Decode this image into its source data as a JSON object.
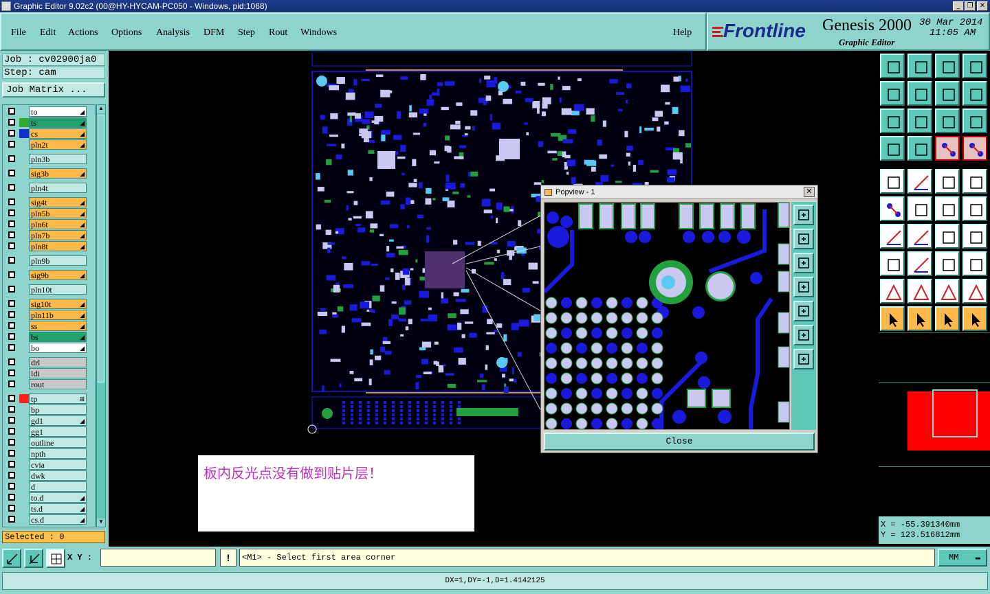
{
  "window": {
    "title": "Graphic Editor 9.02c2 (00@HY-HYCAM-PC050 - Windows, pid:1068)",
    "controls": [
      "_",
      "❐",
      "✕"
    ]
  },
  "menu": {
    "items": [
      "File",
      "Edit",
      "Actions",
      "Options",
      "Analysis",
      "DFM",
      "Step",
      "Rout",
      "Windows"
    ],
    "help": "Help"
  },
  "brand": {
    "logo": "Frontline",
    "product": "Genesis 2000",
    "subtitle": "Graphic Editor",
    "date": "30 Mar 2014",
    "time": "11:05 AM"
  },
  "job": {
    "job_label": "Job : cv02900ja0",
    "step_label": "Step: cam",
    "matrix_button": "Job Matrix ..."
  },
  "layers": [
    {
      "name": "to",
      "bg": "#ffffff",
      "color": "",
      "mark": "◢"
    },
    {
      "name": "ts",
      "bg": "#22a06c",
      "color": "#33aa33",
      "mark": "◢"
    },
    {
      "name": "cs",
      "bg": "#ffb84a",
      "color": "#1030d0",
      "mark": "◢"
    },
    {
      "name": "pln2t",
      "bg": "#ffb84a",
      "color": "",
      "mark": "◢"
    },
    {
      "name": "pln3b",
      "bg": "#bfe8e2",
      "color": "",
      "mark": ""
    },
    {
      "name": "sig3b",
      "bg": "#ffb84a",
      "color": "",
      "mark": "◢"
    },
    {
      "name": "pln4t",
      "bg": "#bfe8e2",
      "color": "",
      "mark": ""
    },
    {
      "name": "sig4t",
      "bg": "#ffb84a",
      "color": "",
      "mark": "◢"
    },
    {
      "name": "pln5b",
      "bg": "#ffb84a",
      "color": "",
      "mark": "◢"
    },
    {
      "name": "pln6t",
      "bg": "#ffb84a",
      "color": "",
      "mark": "◢"
    },
    {
      "name": "pln7b",
      "bg": "#ffb84a",
      "color": "",
      "mark": "◢"
    },
    {
      "name": "pln8t",
      "bg": "#ffb84a",
      "color": "",
      "mark": "◢"
    },
    {
      "name": "pln9b",
      "bg": "#bfe8e2",
      "color": "",
      "mark": ""
    },
    {
      "name": "sig9b",
      "bg": "#ffb84a",
      "color": "",
      "mark": "◢"
    },
    {
      "name": "pln10t",
      "bg": "#bfe8e2",
      "color": "",
      "mark": ""
    },
    {
      "name": "sig10t",
      "bg": "#ffb84a",
      "color": "",
      "mark": "◢"
    },
    {
      "name": "pln11b",
      "bg": "#ffb84a",
      "color": "",
      "mark": "◢"
    },
    {
      "name": "ss",
      "bg": "#ffb84a",
      "color": "",
      "mark": "◢"
    },
    {
      "name": "bs",
      "bg": "#22a06c",
      "color": "",
      "mark": "◢"
    },
    {
      "name": "bo",
      "bg": "#ffffff",
      "color": "",
      "mark": "◢"
    },
    {
      "name": "drl",
      "bg": "#c8c8c8",
      "color": "",
      "mark": ""
    },
    {
      "name": "ldi",
      "bg": "#c8c8c8",
      "color": "",
      "mark": ""
    },
    {
      "name": "rout",
      "bg": "#c8c8c8",
      "color": "",
      "mark": ""
    },
    {
      "name": "tp",
      "bg": "#bfe8e2",
      "color": "#ff2020",
      "mark": "⊞"
    },
    {
      "name": "bp",
      "bg": "#bfe8e2",
      "color": "",
      "mark": ""
    },
    {
      "name": "gd1",
      "bg": "#bfe8e2",
      "color": "",
      "mark": "◢"
    },
    {
      "name": "gg1",
      "bg": "#bfe8e2",
      "color": "",
      "mark": ""
    },
    {
      "name": "outline",
      "bg": "#bfe8e2",
      "color": "",
      "mark": ""
    },
    {
      "name": "npth",
      "bg": "#bfe8e2",
      "color": "",
      "mark": ""
    },
    {
      "name": "cvia",
      "bg": "#bfe8e2",
      "color": "",
      "mark": ""
    },
    {
      "name": "dwk",
      "bg": "#bfe8e2",
      "color": "",
      "mark": ""
    },
    {
      "name": "d",
      "bg": "#bfe8e2",
      "color": "",
      "mark": ""
    },
    {
      "name": "to.d",
      "bg": "#bfe8e2",
      "color": "",
      "mark": "◢"
    },
    {
      "name": "ts.d",
      "bg": "#bfe8e2",
      "color": "",
      "mark": "◢"
    },
    {
      "name": "cs.d",
      "bg": "#bfe8e2",
      "color": "",
      "mark": "◢"
    }
  ],
  "selected": "Selected : 0",
  "popview": {
    "title": "Popview - 1",
    "close_label": "Close"
  },
  "note": {
    "text": "板内反光点没有做到贴片层！"
  },
  "coords": {
    "x": "X  = -55.391340mm",
    "y": "Y  = 123.516812mm"
  },
  "bottom": {
    "xy_label": "X Y :",
    "xy_value": "",
    "prompt": "<M1> - Select first area corner",
    "units": "MM"
  },
  "status": {
    "text": "DX=1,DY=-1,D=1.4142125"
  },
  "colors": {
    "panel": "#8fd4cc",
    "orange": "#ffb84a",
    "board_blue": "#1a1adc",
    "pad": "#c8c8f0"
  }
}
